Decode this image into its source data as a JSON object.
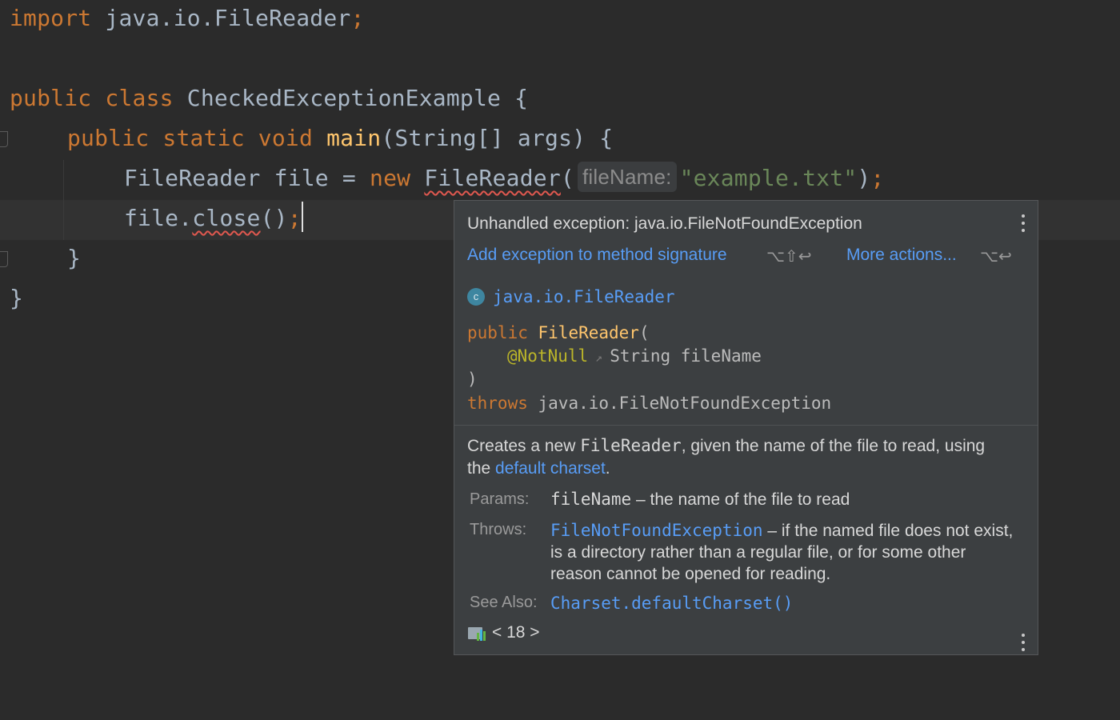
{
  "editor": {
    "line1": {
      "kw": "import",
      "text": " java.io.FileReader",
      "semi": ";"
    },
    "line3": {
      "kw": "public class",
      "text": " CheckedExceptionExample {"
    },
    "line4": {
      "kw1": "public static void",
      "fn": "main",
      "text": "(String[] args) {"
    },
    "line5": {
      "pre": "FileReader file = ",
      "kw": "new",
      "cls": "FileReader",
      "paren": "(",
      "hint": "fileName:",
      "str": "\"example.txt\"",
      "close": ")",
      "semi": ";"
    },
    "line6": {
      "obj": "file.",
      "method": "close",
      "parens": "()",
      "semi": ";"
    },
    "line7": "}",
    "line8": "}"
  },
  "popup": {
    "error_title": "Unhandled exception: java.io.FileNotFoundException",
    "fix_action": "Add exception to method signature",
    "fix_shortcut": "⌥⇧↩",
    "more_actions": "More actions...",
    "more_shortcut": "⌥↩",
    "class_icon_letter": "c",
    "class_name": "java.io.FileReader",
    "signature": {
      "modifier": "public",
      "name": "FileReader",
      "open": "(",
      "annotation": "@NotNull",
      "param": "String fileName",
      "close": ")",
      "throws_kw": "throws",
      "throws_type": "java.io.FileNotFoundException"
    },
    "doc": {
      "desc_pre": "Creates a new ",
      "desc_code": "FileReader",
      "desc_mid": ", given the name of the file to read, using the ",
      "desc_link": "default charset",
      "desc_end": ".",
      "params_label": "Params:",
      "params_code": "fileName",
      "params_text": " – the name of the file to read",
      "throws_label": "Throws:",
      "throws_link": "FileNotFoundException",
      "throws_text": " – if the named file does not exist, is a directory rather than a regular file, or for some other reason cannot be opened for reading.",
      "see_label": "See Also:",
      "see_link": "Charset.defaultCharset()",
      "jdk_version": "< 18 >"
    }
  },
  "colors": {
    "background": "#2b2b2b",
    "keyword": "#cc7832",
    "function": "#ffc66d",
    "string": "#6a8759",
    "link": "#589df6",
    "error": "#e0584f"
  },
  "icons": [
    "class-icon",
    "jdk-library-icon",
    "more-options-icon"
  ]
}
